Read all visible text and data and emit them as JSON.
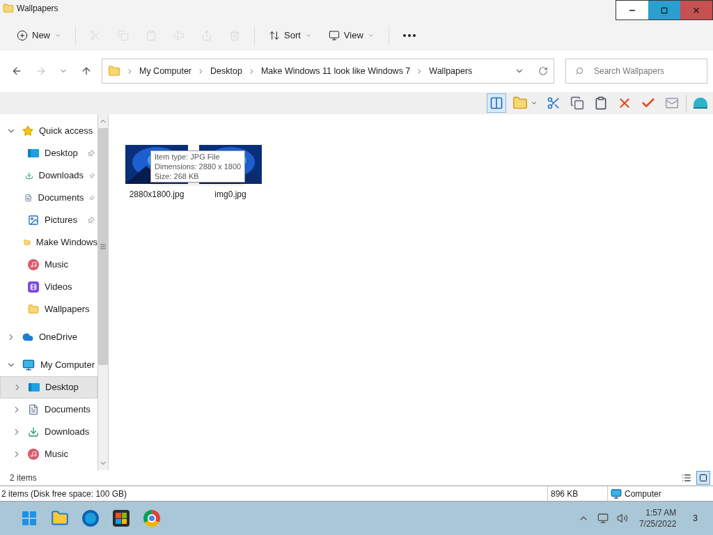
{
  "window": {
    "title": "Wallpapers",
    "controls": [
      {
        "kind": "minimize",
        "hovered": false
      },
      {
        "kind": "restore",
        "hovered": true
      },
      {
        "kind": "close",
        "hovered": false
      }
    ]
  },
  "toolbar": [
    {
      "kind": "new",
      "label": "New",
      "disabled": false
    },
    {
      "kind": "cut",
      "disabled": true
    },
    {
      "kind": "copy",
      "disabled": true
    },
    {
      "kind": "paste",
      "disabled": true
    },
    {
      "kind": "rename",
      "disabled": true
    },
    {
      "kind": "share",
      "disabled": true
    },
    {
      "kind": "delete",
      "disabled": true
    },
    {
      "kind": "sort",
      "label": "Sort",
      "disabled": false
    },
    {
      "kind": "view",
      "label": "View",
      "disabled": false
    },
    {
      "kind": "more",
      "disabled": false
    }
  ],
  "address": {
    "path": [
      "My Computer",
      "Desktop",
      "Make Windows 11 look like Windows 7",
      "Wallpapers"
    ],
    "search_placeholder": "Search Wallpapers"
  },
  "pane_toggle": {
    "pressed": true
  },
  "classic_toolbar": [
    {
      "kind": "select"
    },
    {
      "kind": "cut"
    },
    {
      "kind": "copy"
    },
    {
      "kind": "paste"
    },
    {
      "kind": "delete"
    },
    {
      "kind": "check"
    },
    {
      "kind": "mail"
    },
    {
      "kind": "shell"
    }
  ],
  "sidebar": [
    {
      "label": "Quick access",
      "kind": "star",
      "expanded": true,
      "selected": false,
      "children": [
        {
          "label": "Desktop",
          "kind": "desktop",
          "pinned": true,
          "selected": false
        },
        {
          "label": "Downloads",
          "kind": "download",
          "pinned": true,
          "selected": false
        },
        {
          "label": "Documents",
          "kind": "document",
          "pinned": true,
          "selected": false
        },
        {
          "label": "Pictures",
          "kind": "picture",
          "pinned": true,
          "selected": false
        },
        {
          "label": "Make Windows",
          "kind": "folder",
          "pinned": false,
          "selected": false
        },
        {
          "label": "Music",
          "kind": "music",
          "pinned": false,
          "selected": false
        },
        {
          "label": "Videos",
          "kind": "video",
          "pinned": false,
          "selected": false
        },
        {
          "label": "Wallpapers",
          "kind": "folder",
          "pinned": false,
          "selected": false
        }
      ]
    },
    {
      "label": "OneDrive",
      "kind": "cloud",
      "expanded": false,
      "selected": false
    },
    {
      "label": "My Computer",
      "kind": "computer",
      "expanded": true,
      "selected": false,
      "children": [
        {
          "label": "Desktop",
          "kind": "desktop",
          "expanded": false,
          "selected": true
        },
        {
          "label": "Documents",
          "kind": "document",
          "expanded": false,
          "selected": false
        },
        {
          "label": "Downloads",
          "kind": "download",
          "expanded": false,
          "selected": false
        },
        {
          "label": "Music",
          "kind": "music",
          "expanded": false,
          "selected": false
        }
      ]
    }
  ],
  "files": [
    {
      "name": "2880x1800.jpg",
      "kind": "picture"
    },
    {
      "name": "img0.jpg",
      "kind": "picture"
    }
  ],
  "tooltip": [
    "Item type: JPG File",
    "Dimensions: 2880 x 1800",
    "Size: 268 KB"
  ],
  "status": {
    "count": "2 items",
    "views": [
      {
        "kind": "details",
        "selected": false
      },
      {
        "kind": "large",
        "selected": true
      }
    ]
  },
  "classic_status": {
    "summary": "2 items (Disk free space: 100 GB)",
    "size": "896 KB",
    "location": "Computer"
  },
  "taskbar": {
    "apps": [
      {
        "kind": "start"
      },
      {
        "kind": "explorer"
      },
      {
        "kind": "edge"
      },
      {
        "kind": "store"
      },
      {
        "kind": "chrome"
      }
    ],
    "time": "1:57 AM",
    "date": "7/25/2022",
    "notifications": "3"
  }
}
